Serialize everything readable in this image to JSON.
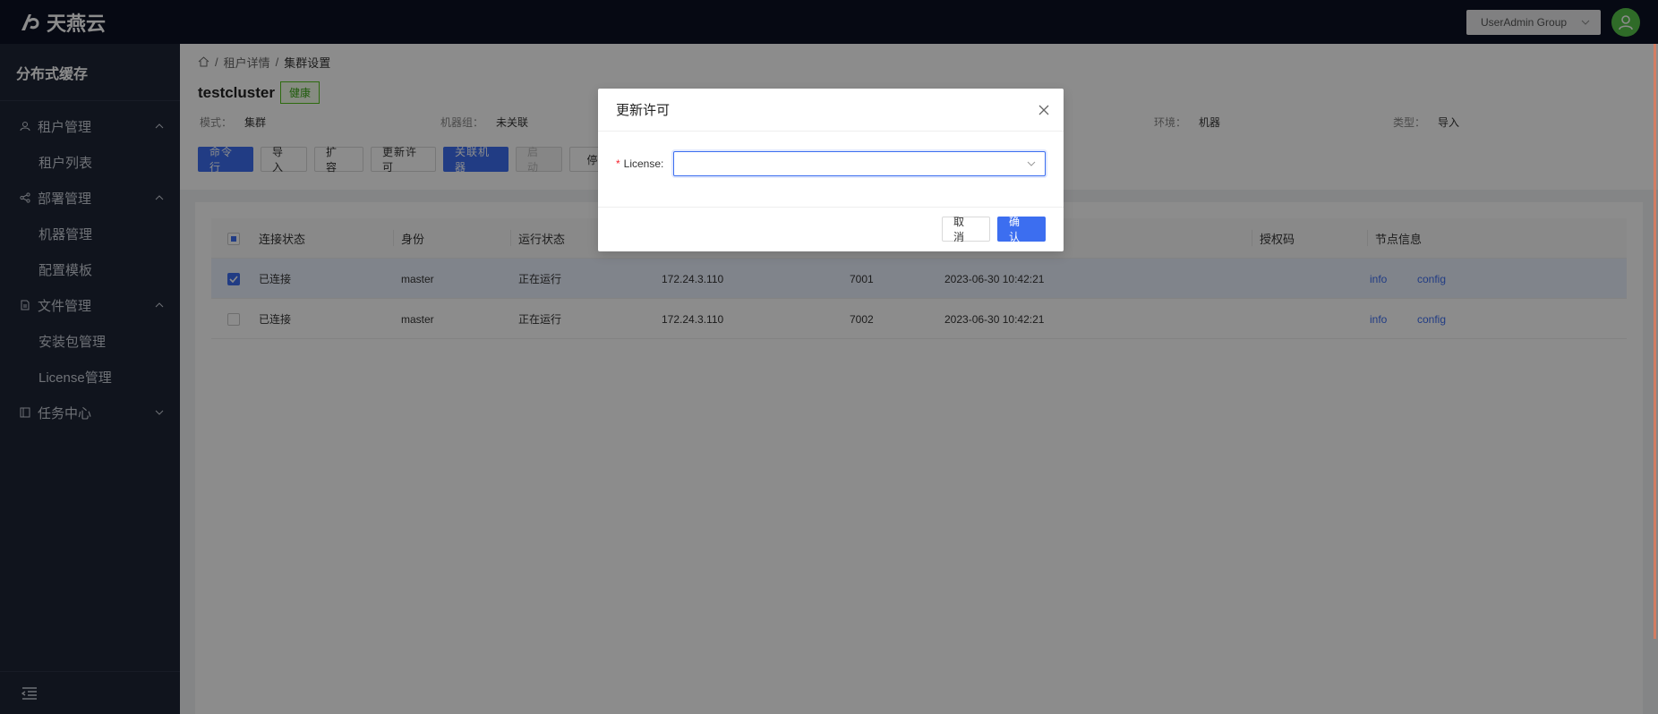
{
  "app": {
    "brand": "天燕云"
  },
  "header": {
    "group_select": "UserAdmin Group"
  },
  "sidebar": {
    "title": "分布式缓存",
    "groups": [
      {
        "label": "租户管理",
        "items": [
          "租户列表"
        ]
      },
      {
        "label": "部署管理",
        "items": [
          "机器管理",
          "配置模板"
        ]
      },
      {
        "label": "文件管理",
        "items": [
          "安装包管理",
          "License管理"
        ]
      },
      {
        "label": "任务中心",
        "items": []
      }
    ]
  },
  "breadcrumb": {
    "sep": "/",
    "items": [
      "租户详情",
      "集群设置"
    ]
  },
  "cluster": {
    "name": "testcluster",
    "health": "健康",
    "info": [
      {
        "label": "模式：",
        "value": "集群"
      },
      {
        "label": "机器组：",
        "value": "未关联"
      },
      {
        "label": "环境：",
        "value": "机器"
      },
      {
        "label": "类型：",
        "value": "导入"
      }
    ]
  },
  "actions": {
    "cmd": "命令行",
    "import": "导 入",
    "expand": "扩 容",
    "update_license": "更新许可",
    "link_machine": "关联机器",
    "start": "启 动",
    "stop": "停"
  },
  "table": {
    "headers": {
      "conn": "连接状态",
      "role": "身份",
      "run": "运行状态",
      "auth": "授权码",
      "node": "节点信息"
    },
    "rows": [
      {
        "conn": "已连接",
        "role": "master",
        "run": "正在运行",
        "ip": "172.24.3.110",
        "port": "7001",
        "time": "2023-06-30 10:42:21",
        "info": "info",
        "config": "config",
        "selected": true
      },
      {
        "conn": "已连接",
        "role": "master",
        "run": "正在运行",
        "ip": "172.24.3.110",
        "port": "7002",
        "time": "2023-06-30 10:42:21",
        "info": "info",
        "config": "config",
        "selected": false
      }
    ]
  },
  "modal": {
    "title": "更新许可",
    "field_label": "License",
    "field_colon": ":",
    "required_mark": "*",
    "placeholder": "",
    "cancel": "取 消",
    "confirm": "确 认"
  }
}
